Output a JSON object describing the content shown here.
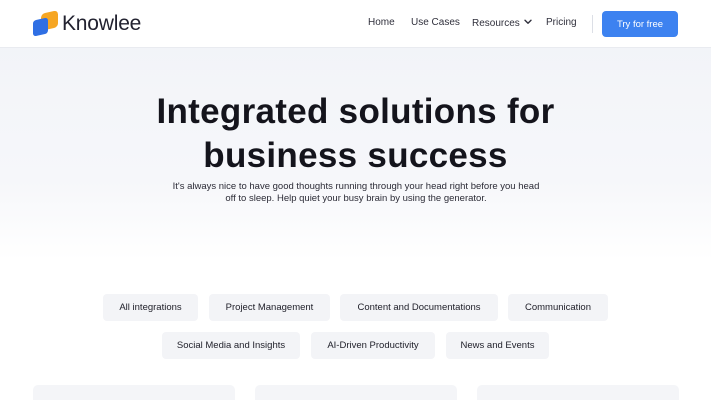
{
  "brand": {
    "name": "Knowlee"
  },
  "nav": {
    "items": [
      {
        "label": "Home"
      },
      {
        "label": "Use Cases"
      },
      {
        "label": "Resources"
      },
      {
        "label": "Pricing"
      }
    ],
    "cta_label": "Try for free"
  },
  "hero": {
    "title_line1": "Integrated solutions for",
    "title_line2": "business success",
    "subtitle_line1": "It's always nice to have good thoughts running through your head right before you head",
    "subtitle_line2": "off to sleep. Help quiet your busy brain by using the generator."
  },
  "filters": {
    "chips": [
      {
        "label": "All integrations"
      },
      {
        "label": "Project Management"
      },
      {
        "label": "Content and Documentations"
      },
      {
        "label": "Communication"
      },
      {
        "label": "Social Media and Insights"
      },
      {
        "label": "AI-Driven Productivity"
      },
      {
        "label": "News and Events"
      }
    ]
  },
  "colors": {
    "accent": "#3d82f0",
    "logo_blue": "#2f6fe4",
    "logo_orange": "#f6a623",
    "chip_bg": "#f3f4f7"
  }
}
